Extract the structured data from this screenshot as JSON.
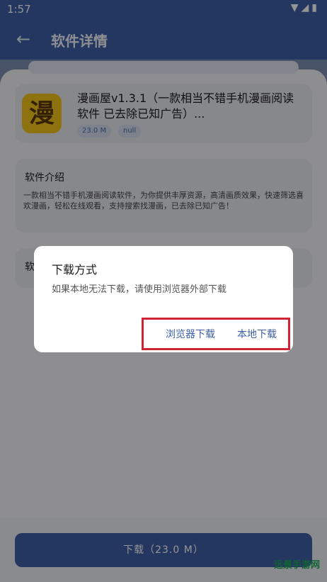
{
  "status": {
    "time": "1:57",
    "icons": "▼◢▮"
  },
  "appbar": {
    "back_icon": "←",
    "title": "软件详情"
  },
  "app": {
    "icon_char": "漫",
    "name": "漫画屋v1.3.1（一款相当不错手机漫画阅读软件 已去除已知广告）...",
    "tags": [
      "23.0 M",
      "null"
    ]
  },
  "intro": {
    "title": "软件介绍",
    "text": "一款相当不错手机漫画阅读软件，为你提供丰厚资源，高清画质效果，快速筛选喜欢漫画，轻松在线观看，支持搜索找漫画，已去除已知广告！"
  },
  "third_card": {
    "title": "软"
  },
  "download_button": {
    "label": "下载（23.0 M）"
  },
  "watermark": "远景手游网",
  "dialog": {
    "title": "下载方式",
    "message": "如果本地无法下载，请使用浏览器外部下载",
    "browser_button": "浏览器下载",
    "local_button": "本地下载"
  },
  "colors": {
    "primary": "#3e5fa6",
    "highlight": "#d02434",
    "icon_bg": "#f3c51b"
  }
}
